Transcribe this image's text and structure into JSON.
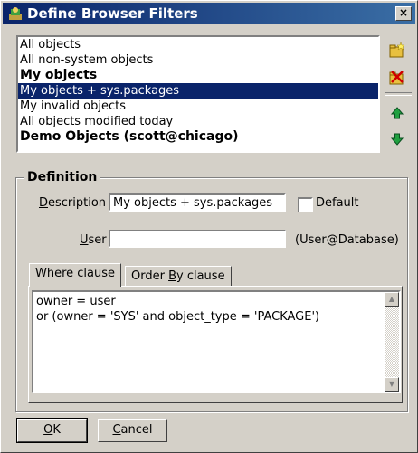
{
  "window": {
    "title": "Define Browser Filters",
    "close_glyph": "×"
  },
  "filters": [
    {
      "label": "All objects",
      "bold": false,
      "selected": false
    },
    {
      "label": "All non-system objects",
      "bold": false,
      "selected": false
    },
    {
      "label": "My objects",
      "bold": true,
      "selected": false
    },
    {
      "label": "My objects + sys.packages",
      "bold": false,
      "selected": true
    },
    {
      "label": "My invalid objects",
      "bold": false,
      "selected": false
    },
    {
      "label": "All objects modified today",
      "bold": false,
      "selected": false
    },
    {
      "label": "Demo Objects (scott@chicago)",
      "bold": true,
      "selected": false
    }
  ],
  "side_buttons": [
    "new-filter-icon",
    "delete-filter-icon",
    "move-up-icon",
    "move-down-icon"
  ],
  "definition": {
    "group_title": "Definition",
    "description_label_underlined": "D",
    "description_label_rest": "escription",
    "description_value": "My objects + sys.packages",
    "default_label": "Default",
    "default_checked": false,
    "user_label_underlined": "U",
    "user_label_rest": "ser",
    "user_value": "",
    "user_hint": "(User@Database)"
  },
  "tabs": {
    "where_underlined": "W",
    "where_rest": "here clause",
    "order_prefix": "Order ",
    "order_underlined": "B",
    "order_rest": "y clause",
    "active": "where"
  },
  "where_clause": [
    "owner = user",
    "or (owner = 'SYS' and object_type = 'PACKAGE')"
  ],
  "buttons": {
    "ok_underlined": "O",
    "ok_rest": "K",
    "cancel_underlined": "C",
    "cancel_rest": "ancel"
  }
}
